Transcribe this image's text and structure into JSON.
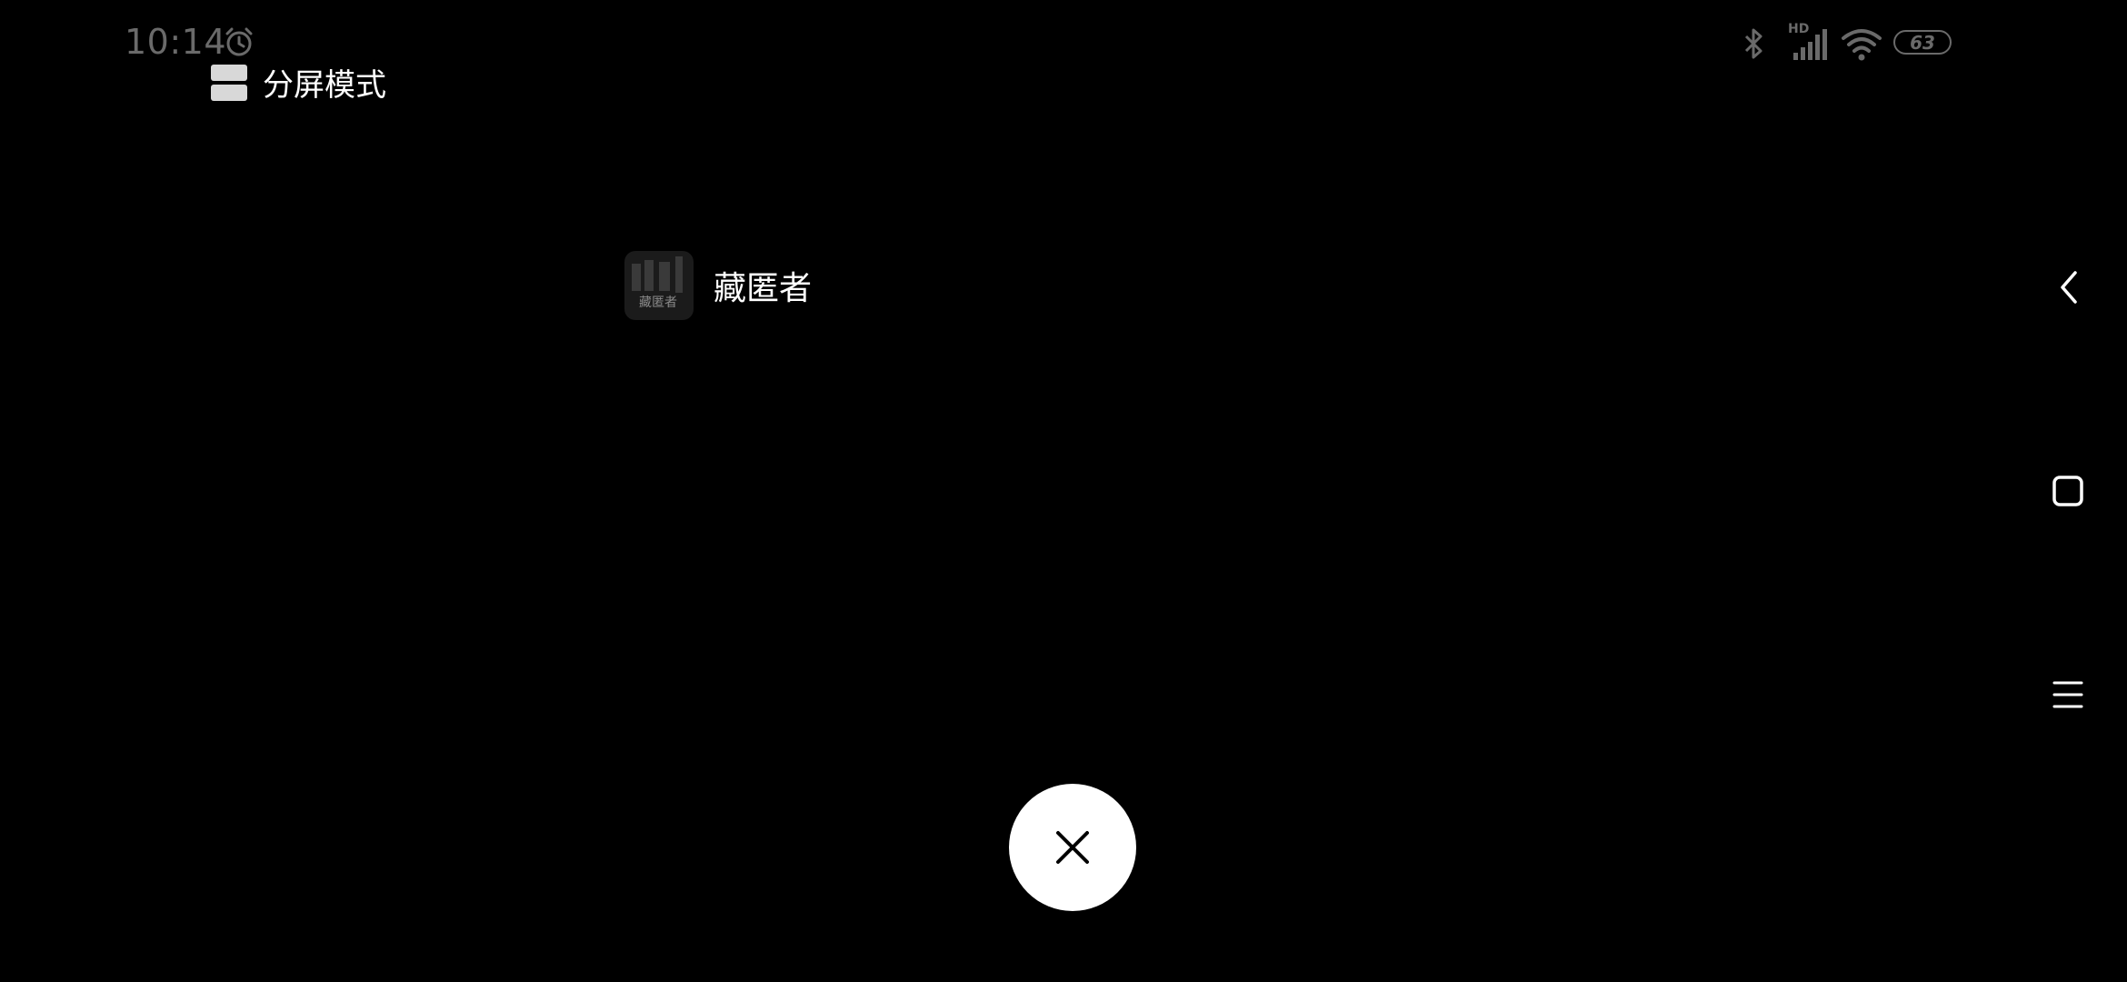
{
  "status_bar": {
    "time": "10:14",
    "icons": [
      "alarm-icon",
      "bluetooth-icon",
      "hd-signal-icon",
      "wifi-icon"
    ],
    "hd_label": "HD",
    "battery_level": "63"
  },
  "split_mode": {
    "title": "分屏模式",
    "icon": "split-screen-icon"
  },
  "apps": [
    {
      "label": "藏匿者",
      "icon_text": "藏匿者"
    }
  ],
  "nav": {
    "back": "back-icon",
    "home": "home-icon",
    "menu": "menu-icon"
  },
  "close_button": {
    "icon": "close-icon"
  },
  "colors": {
    "background": "#000000",
    "status_gray": "#6a6a6a",
    "close_bg": "#ffffff"
  }
}
